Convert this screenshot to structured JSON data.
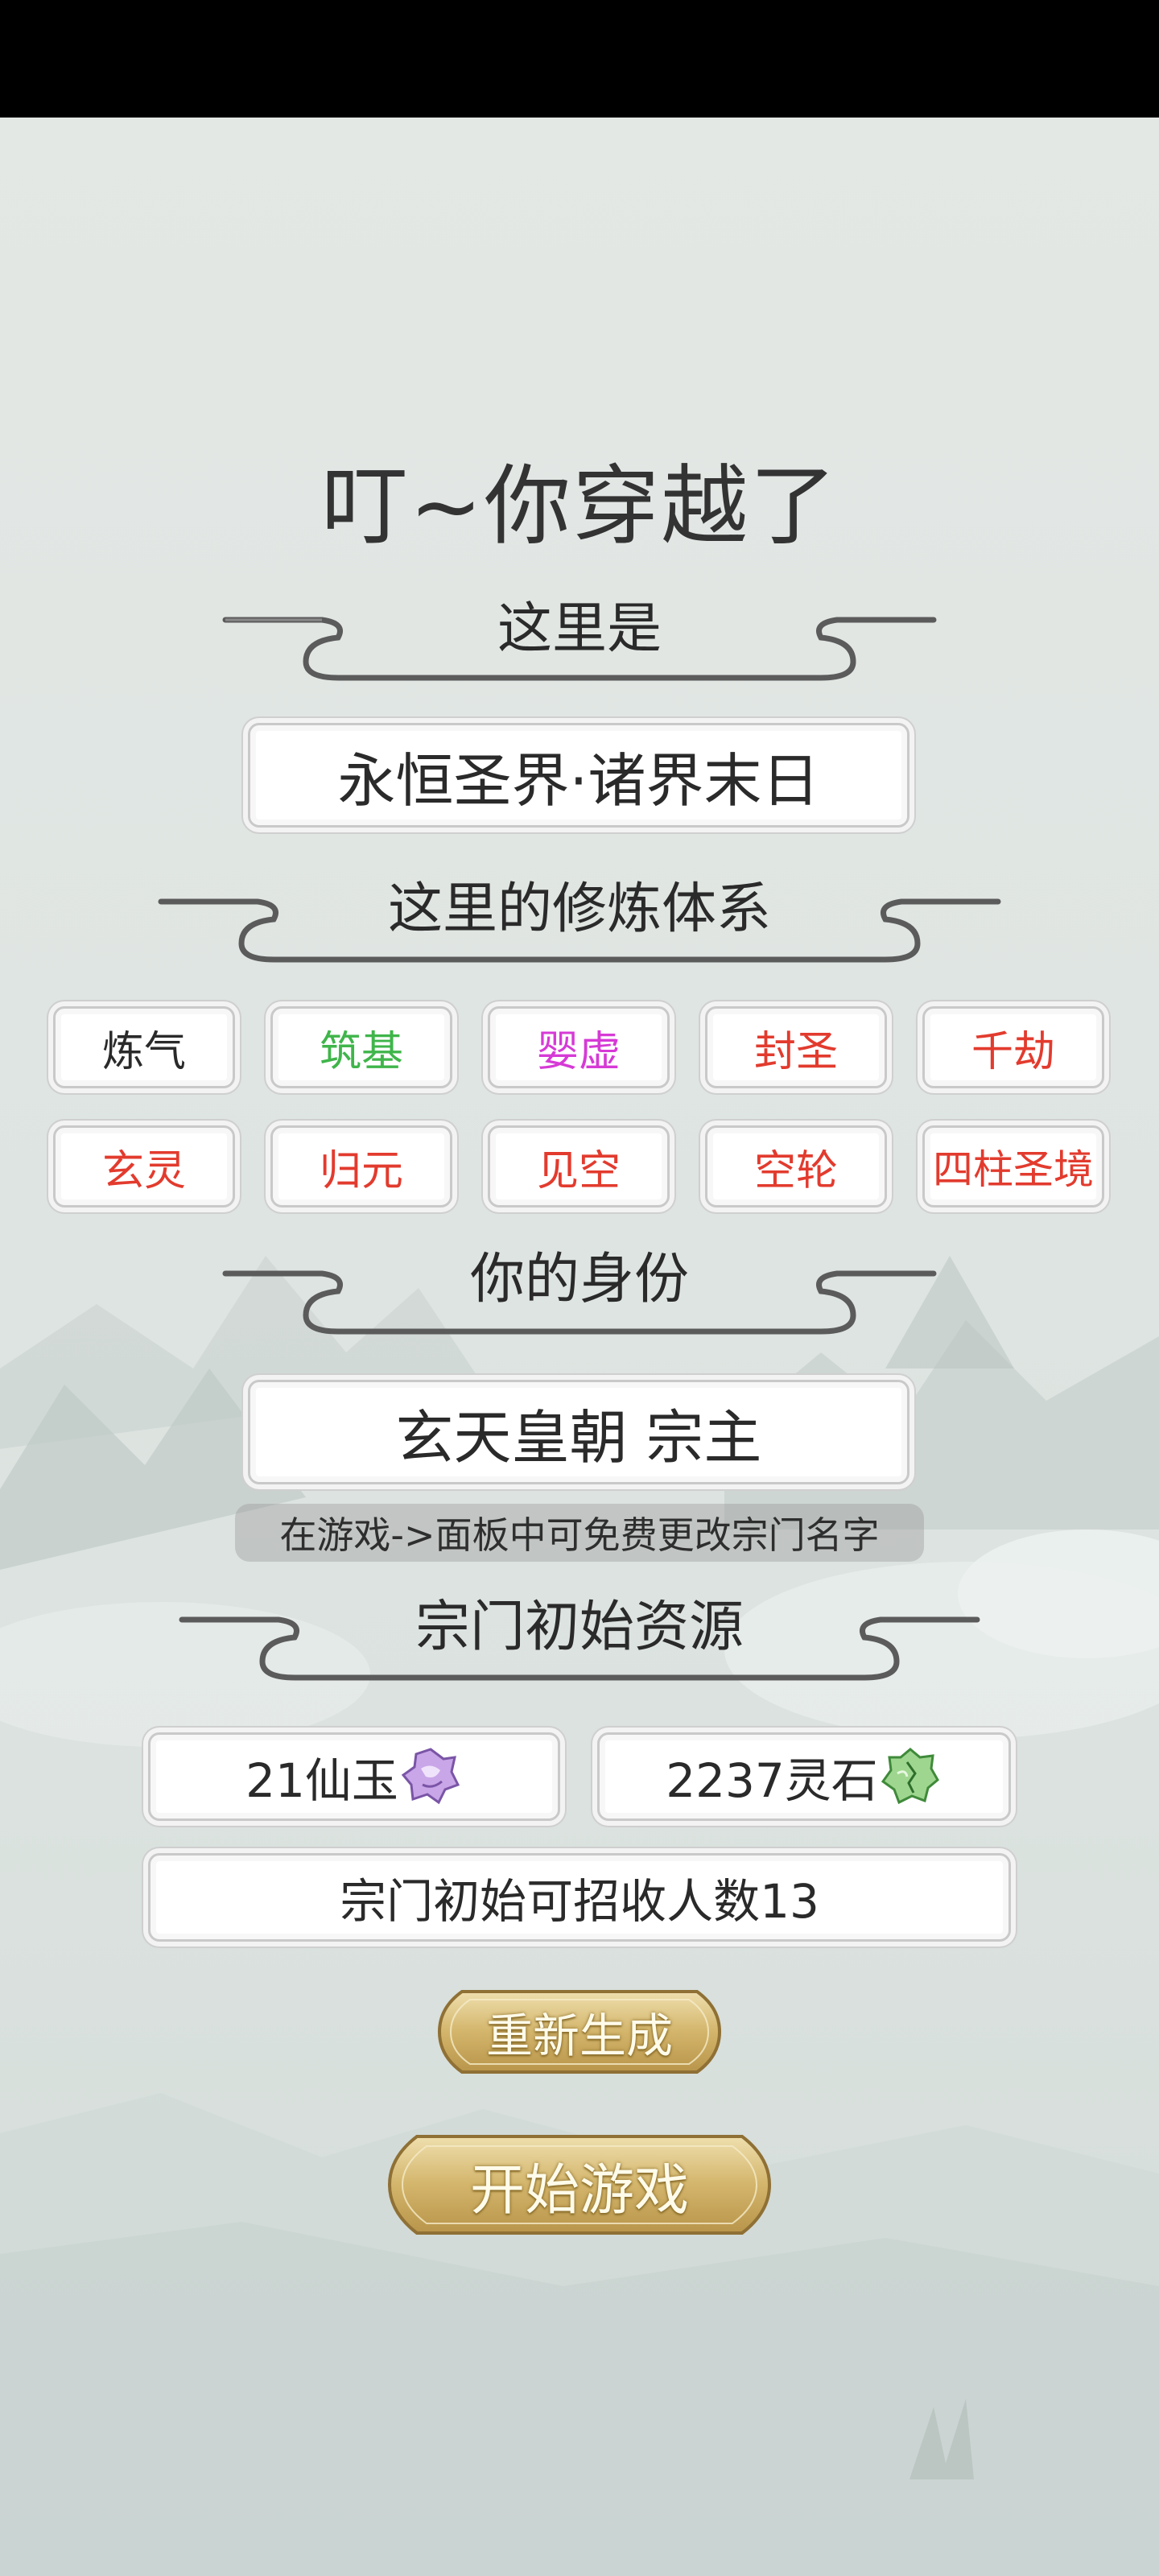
{
  "title": "叮~你穿越了",
  "world": {
    "heading": "这里是",
    "name": "永恒圣界·诸界末日"
  },
  "cultivation": {
    "heading": "这里的修炼体系",
    "realms": [
      {
        "label": "炼气",
        "color": "#2a2a2a"
      },
      {
        "label": "筑基",
        "color": "#3fb54a"
      },
      {
        "label": "婴虚",
        "color": "#d63ad6"
      },
      {
        "label": "封圣",
        "color": "#e23b2e"
      },
      {
        "label": "千劫",
        "color": "#e23b2e"
      },
      {
        "label": "玄灵",
        "color": "#e23b2e"
      },
      {
        "label": "归元",
        "color": "#e23b2e"
      },
      {
        "label": "见空",
        "color": "#e23b2e"
      },
      {
        "label": "空轮",
        "color": "#e23b2e"
      },
      {
        "label": "四柱圣境",
        "color": "#e23b2e"
      }
    ]
  },
  "identity": {
    "heading": "你的身份",
    "value": "玄天皇朝 宗主",
    "hint": "在游戏->面板中可免费更改宗门名字"
  },
  "resources": {
    "heading": "宗门初始资源",
    "jade": "21仙玉",
    "spirit_stone": "2237灵石",
    "recruit": "宗门初始可招收人数13",
    "jade_icon": "purple-jade-icon",
    "stone_icon": "green-spirit-stone-icon"
  },
  "buttons": {
    "regenerate": "重新生成",
    "start": "开始游戏"
  }
}
